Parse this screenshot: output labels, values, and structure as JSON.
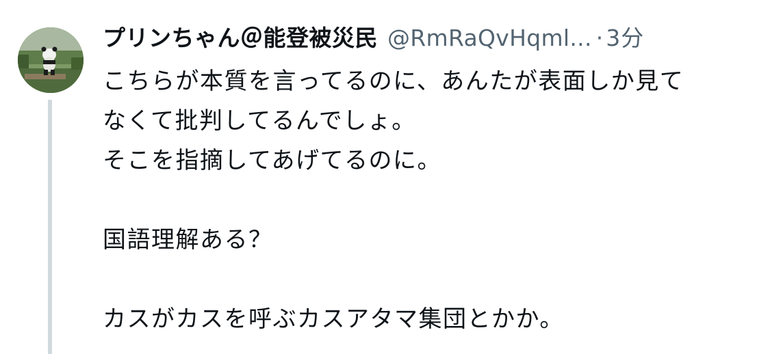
{
  "tweet": {
    "author": {
      "display_name": "プリンちゃん＠能登被災民",
      "handle": "@RmRaQvHqml...",
      "avatar_icon": "panda-avatar-icon"
    },
    "separator": "·",
    "time": "3分",
    "lines": [
      "こちらが本質を言ってるのに、あんたが表面しか見て",
      "なくて批判してるんでしょ。",
      "そこを指摘してあげてるのに。",
      "",
      "国語理解ある？",
      "",
      "カスがカスを呼ぶカスアタマ集団とかか。"
    ]
  },
  "colors": {
    "text": "#0f1419",
    "secondary": "#536471",
    "thread_line": "#cfd9de",
    "background": "#ffffff"
  }
}
